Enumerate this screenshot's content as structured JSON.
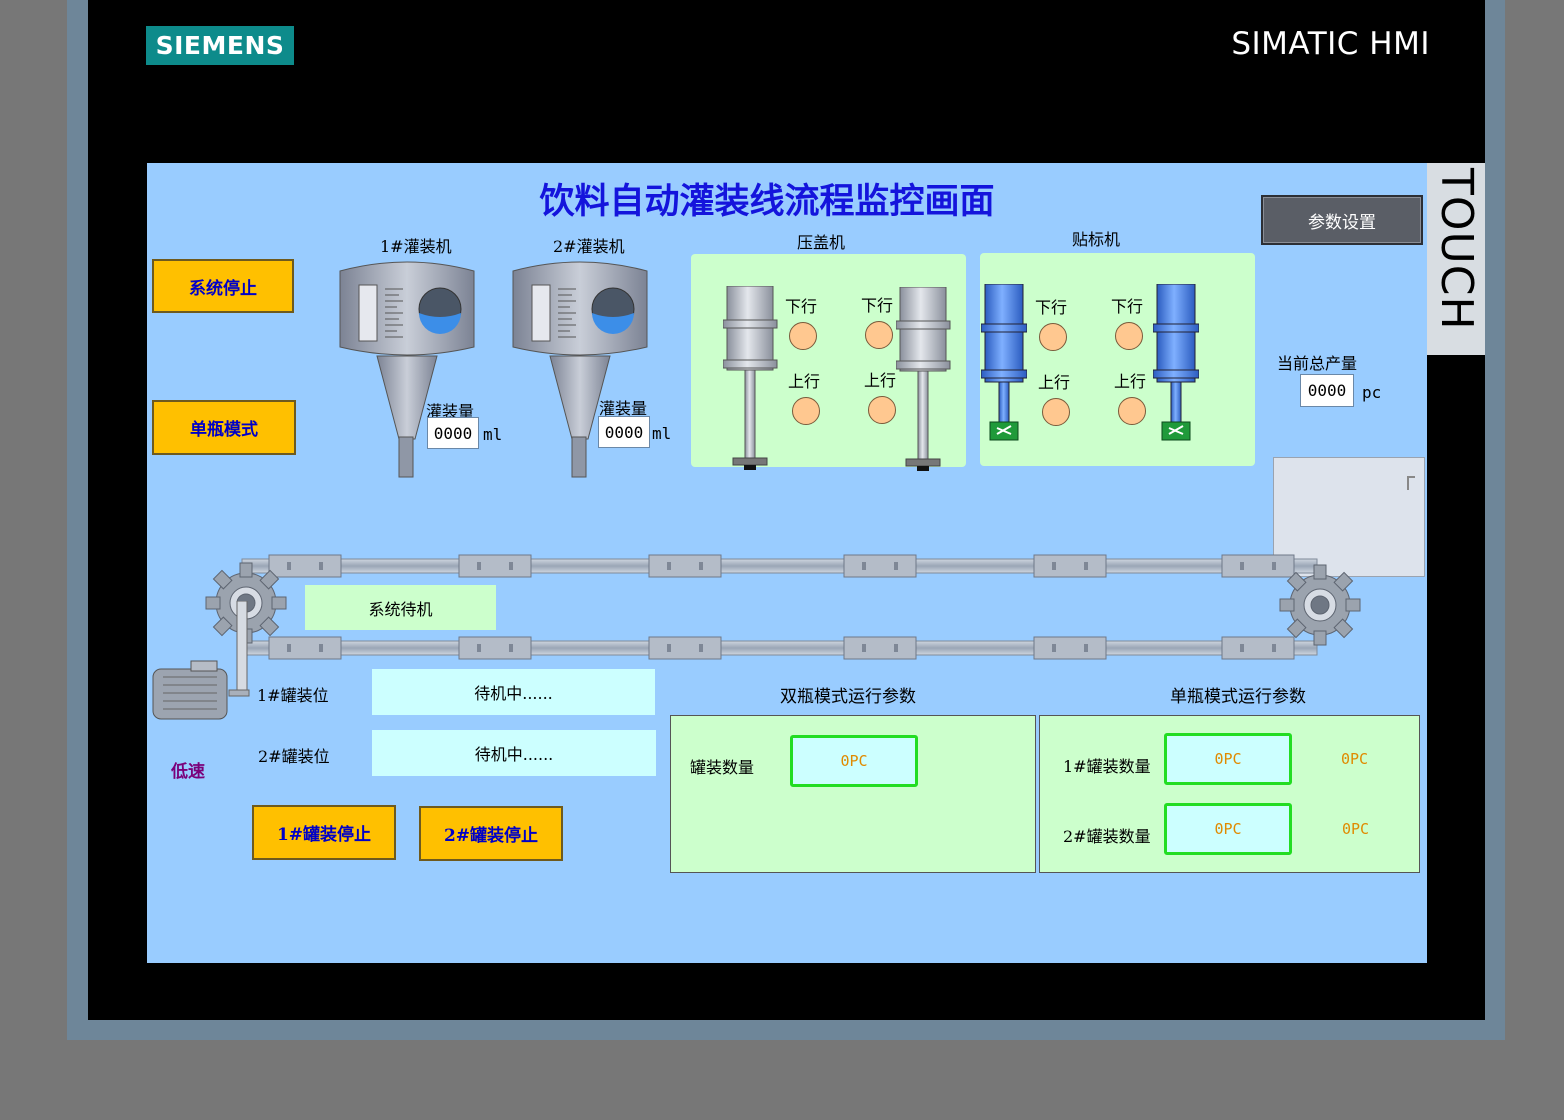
{
  "device": {
    "brand": "SIEMENS",
    "model": "SIMATIC HMI",
    "side_label": "TOUCH"
  },
  "screen": {
    "title": "饮料自动灌装线流程监控画面",
    "buttons": {
      "system_stop": "系统停止",
      "single_mode": "单瓶模式",
      "params": "参数设置",
      "filler1_stop": "1#罐装停止",
      "filler2_stop": "2#罐装停止"
    },
    "filler1": {
      "label": "1#灌装机",
      "amount_label": "灌装量",
      "amount": "0000",
      "unit": "ml"
    },
    "filler2": {
      "label": "2#灌装机",
      "amount_label": "灌装量",
      "amount": "0000",
      "unit": "ml"
    },
    "capper": {
      "label": "压盖机",
      "down": "下行",
      "up": "上行"
    },
    "labeler": {
      "label": "贴标机",
      "down": "下行",
      "up": "上行"
    },
    "production": {
      "label": "当前总产量",
      "value": "0000",
      "unit": "pc"
    },
    "system_status": "系统待机",
    "motor_speed": "低速",
    "stations": [
      {
        "label": "1#罐装位",
        "status": "待机中......"
      },
      {
        "label": "2#罐装位",
        "status": "待机中......"
      }
    ],
    "dual_mode": {
      "title": "双瓶模式运行参数",
      "count_label": "罐装数量",
      "count": "0PC"
    },
    "single_mode": {
      "title": "单瓶模式运行参数",
      "rows": [
        {
          "label": "1#罐装数量",
          "count": "0PC",
          "extra": "0PC"
        },
        {
          "label": "2#罐装数量",
          "count": "0PC",
          "extra": "0PC"
        }
      ]
    },
    "colors": {
      "background": "#99ccff",
      "title": "#1414dc",
      "button": "#ffc000",
      "panel": "#ccffcc",
      "lamp": "#ffc890"
    }
  }
}
